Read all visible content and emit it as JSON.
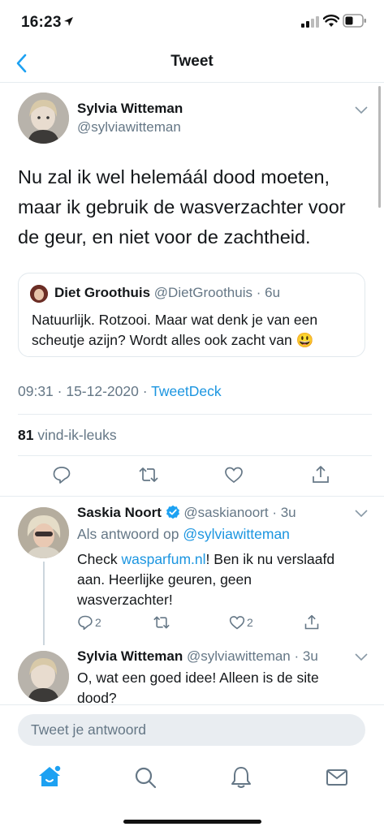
{
  "status_bar": {
    "time": "16:23"
  },
  "nav": {
    "title": "Tweet"
  },
  "tweet": {
    "author_name": "Sylvia Witteman",
    "author_handle": "@sylviawitteman",
    "text_lines": [
      "Nu zal ik wel helemáál dood moeten,",
      "maar ik gebruik de wasverzachter voor",
      "de geur, en niet voor de zachtheid."
    ],
    "quote": {
      "name": "Diet Groothuis",
      "handle": "@DietGroothuis",
      "time": "· 6u",
      "line1": "Natuurlijk. Rotzooi. Maar wat denk je van een",
      "line2": "scheutje azijn? Wordt alles ook zacht van",
      "emoji": "😃"
    },
    "meta_time": "09:31 · 15-12-2020 · ",
    "meta_source": "TweetDeck",
    "likes_count": "81",
    "likes_label": "vind-ik-leuks"
  },
  "replies": [
    {
      "name": "Saskia Noort",
      "handle": "@saskianoort",
      "time": "· 3u",
      "reply_to_prefix": "Als antwoord op ",
      "reply_to_handle": "@sylviawitteman",
      "text_pre": "Check ",
      "text_link": "wasparfum.nl",
      "text_post_line1": "! Ben ik nu verslaafd",
      "text_line2": "aan. Heerlijke geuren, geen",
      "text_line3": "wasverzachter!",
      "reply_count": "2",
      "like_count": "2"
    },
    {
      "name": "Sylvia Witteman",
      "handle": "@sylviawitteman",
      "time": "· 3u",
      "text_line1": "O, wat een goed idee! Alleen is de site",
      "text_line2": "dood?"
    }
  ],
  "compose": {
    "placeholder": "Tweet je antwoord"
  },
  "colors": {
    "accent": "#1da1f2",
    "link": "#1b95e0",
    "secondary": "#657786",
    "verified": "#1da1f2"
  },
  "icons": [
    "back-chevron-icon",
    "reply-icon",
    "retweet-icon",
    "like-icon",
    "share-icon",
    "verified-icon",
    "home-icon",
    "search-icon",
    "notifications-icon",
    "messages-icon"
  ]
}
